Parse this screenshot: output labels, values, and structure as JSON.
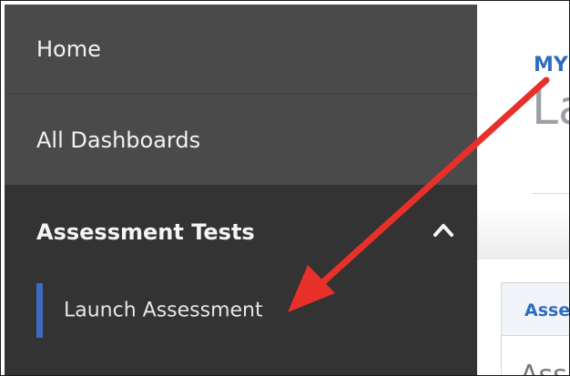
{
  "sidebar": {
    "items": [
      {
        "label": "Home"
      },
      {
        "label": "All Dashboards"
      }
    ],
    "section": {
      "title": "Assessment Tests",
      "sub_items": [
        {
          "label": "Launch Assessment",
          "active": true
        }
      ]
    }
  },
  "content": {
    "brand": "MY",
    "page_title": "La",
    "card_tab": "Asse",
    "card_body": "Ass"
  },
  "colors": {
    "sidebar_bg": "#4a4a4a",
    "section_bg": "#333333",
    "active_marker": "#3b6cc2",
    "link_blue": "#2f6cc1",
    "arrow": "#e8302a"
  },
  "icons": {
    "section_toggle": "chevron-up-icon",
    "annotation": "red-arrow"
  }
}
